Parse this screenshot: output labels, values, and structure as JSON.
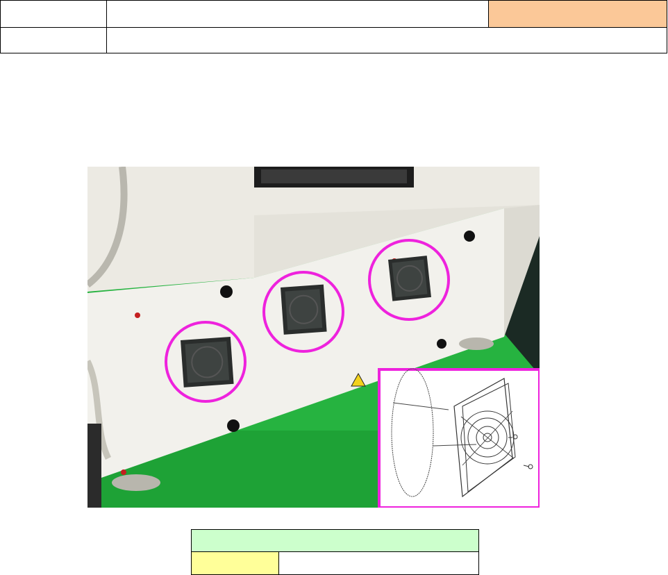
{
  "header": {
    "row1_label": "",
    "row1_title": "",
    "row1_status": "",
    "row2_label": "",
    "row2_text": "",
    "status_color": "#fbc898"
  },
  "photo": {
    "highlight_color": "#ee22dd",
    "panel_color": "#f2f1ec",
    "floor_color": "#25b33e",
    "filter_count": 3,
    "inset_caption": ""
  },
  "footer": {
    "title": "",
    "label": "",
    "value": "",
    "title_color": "#ccffcc",
    "label_color": "#ffff99"
  }
}
